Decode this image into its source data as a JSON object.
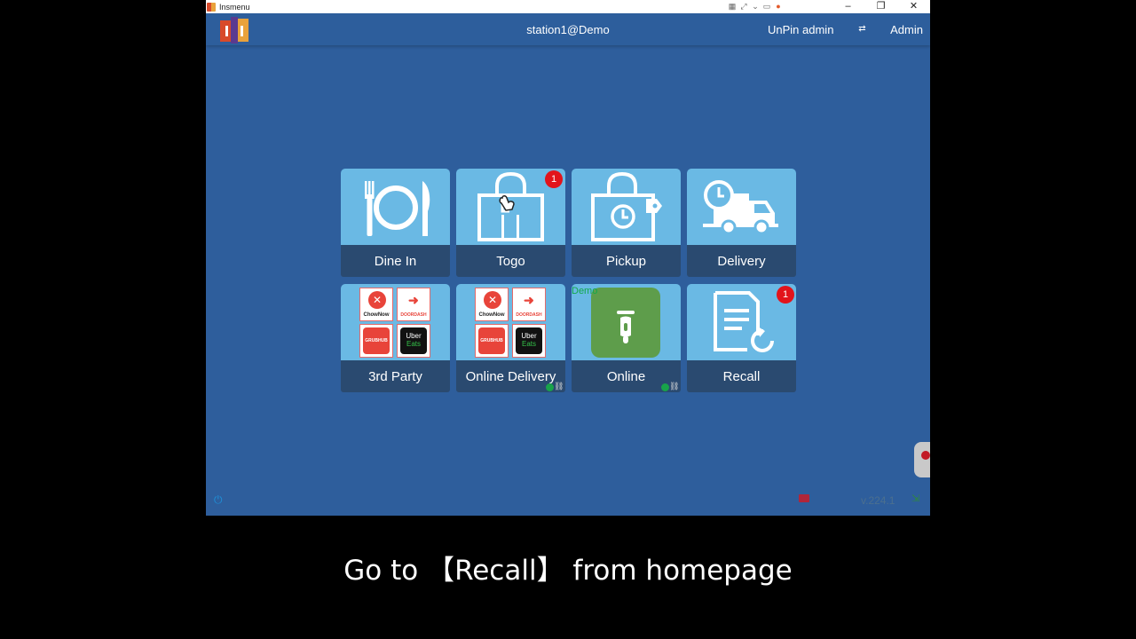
{
  "window": {
    "title": "Insmenu"
  },
  "header": {
    "station": "station1@Demo",
    "unpin_label": "UnPin admin",
    "language_icon": "language-icon",
    "user_label": "Admin"
  },
  "tiles": [
    {
      "label": "Dine In",
      "icon": "plate-icon"
    },
    {
      "label": "Togo",
      "icon": "bag-icon",
      "badge": "1"
    },
    {
      "label": "Pickup",
      "icon": "pickup-bag-icon"
    },
    {
      "label": "Delivery",
      "icon": "truck-icon"
    },
    {
      "label": "3rd Party",
      "icon": "partners-icon"
    },
    {
      "label": "Online Delivery",
      "icon": "partners-icon"
    },
    {
      "label": "Online",
      "icon": "scooter-icon",
      "tag": "Demo"
    },
    {
      "label": "Recall",
      "icon": "recall-icon",
      "badge": "1"
    }
  ],
  "partners": {
    "chownow": "ChowNow",
    "doordash": "DOORDASH",
    "grubhub": "GRUBHUB",
    "uber_top": "Uber",
    "uber_bottom": "Eats"
  },
  "footer": {
    "version": "v.224.1"
  },
  "caption": "Go to 【Recall】 from homepage",
  "colors": {
    "background": "#2e5e9c",
    "tile": "#6ab9e4",
    "tile_label_bg": "#2a4a70",
    "badge": "#e2141b",
    "online_green": "#5e9d4b"
  }
}
